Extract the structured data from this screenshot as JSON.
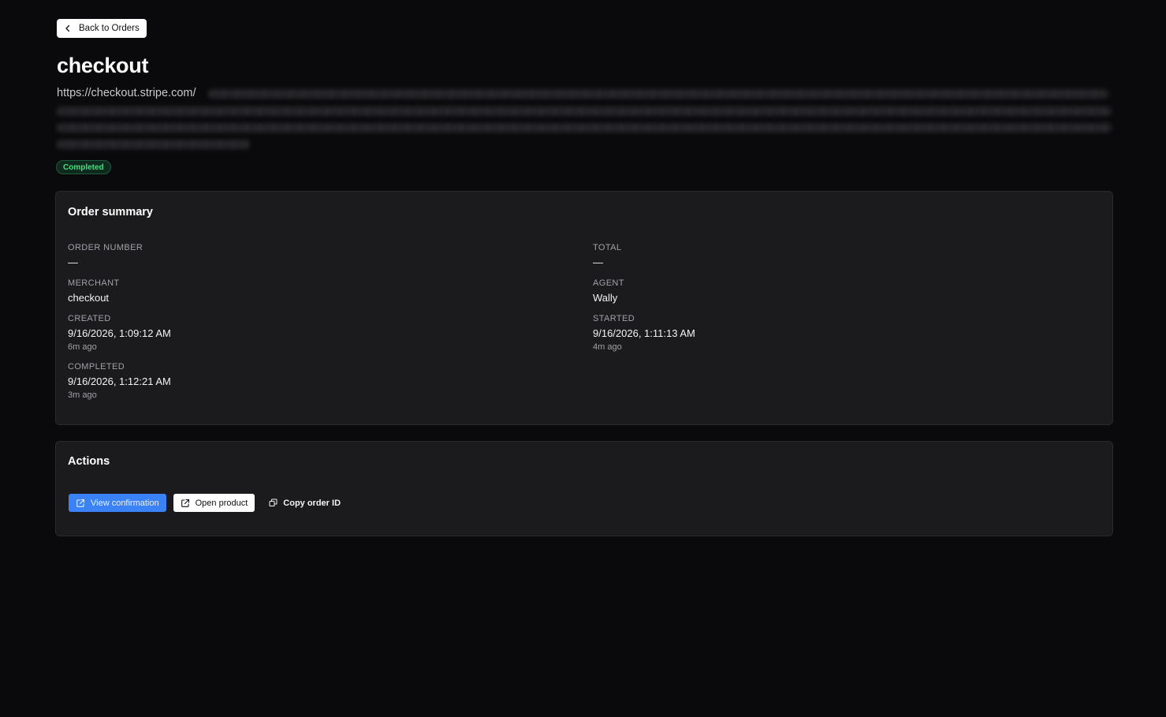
{
  "back_button": {
    "label": "Back to Orders",
    "icon": "chevron-left-icon"
  },
  "title": "checkout",
  "url": {
    "visible_text": "https://checkout.stripe.com/"
  },
  "status": {
    "label": "Completed",
    "color": "#4ade80"
  },
  "summary": {
    "title": "Order summary",
    "fields": {
      "order_number": {
        "label": "ORDER NUMBER",
        "value": "—"
      },
      "total": {
        "label": "TOTAL",
        "value": "—"
      },
      "merchant": {
        "label": "MERCHANT",
        "value": "checkout"
      },
      "agent": {
        "label": "AGENT",
        "value": "Wally"
      },
      "created": {
        "label": "CREATED",
        "value": "9/16/2026, 1:09:12 AM",
        "relative": "6m ago"
      },
      "started": {
        "label": "STARTED",
        "value": "9/16/2026, 1:11:13 AM",
        "relative": "4m ago"
      },
      "completed": {
        "label": "COMPLETED",
        "value": "9/16/2026, 1:12:21 AM",
        "relative": "3m ago"
      }
    }
  },
  "actions": {
    "title": "Actions",
    "view_confirmation": {
      "label": "View confirmation",
      "icon": "external-link-icon",
      "color": "#3b82f6"
    },
    "open_product": {
      "label": "Open product",
      "icon": "external-link-icon"
    },
    "copy_order_id": {
      "label": "Copy order ID",
      "icon": "copy-icon"
    }
  }
}
